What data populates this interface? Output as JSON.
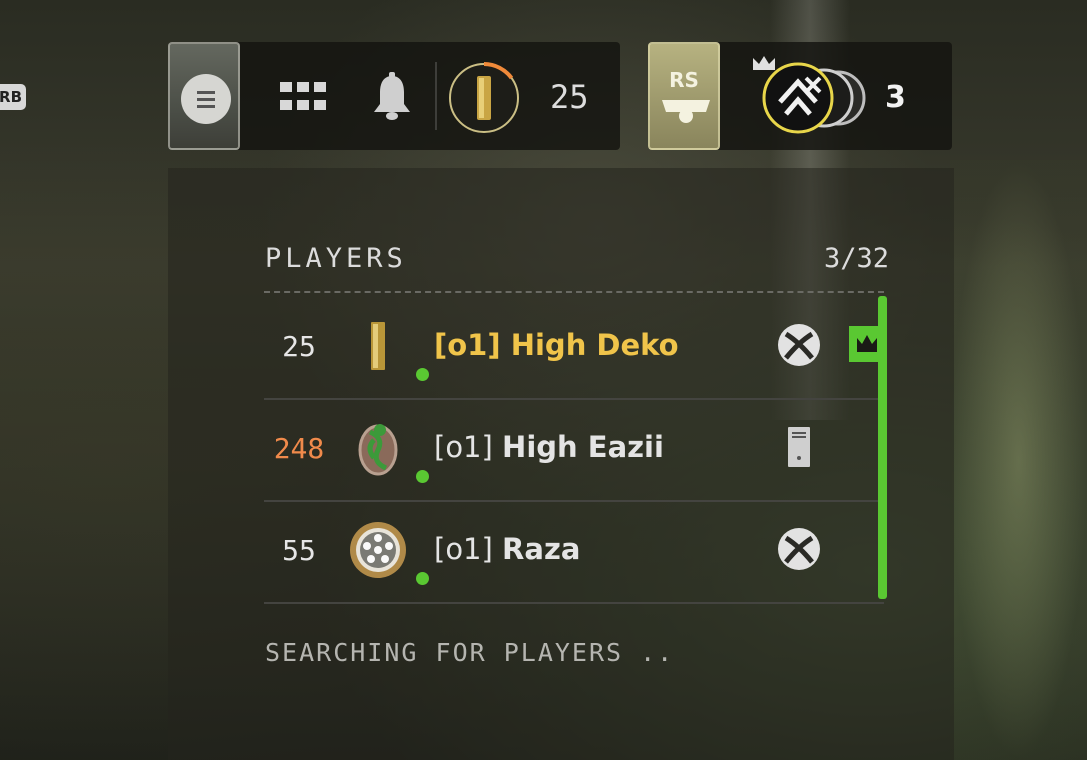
{
  "edge_hint": {
    "label": "RB"
  },
  "topbar": {
    "level": "25",
    "rs_label": "RS",
    "party_count": "3",
    "xp_progress": 0.15
  },
  "players_panel": {
    "title": "PLAYERS",
    "count": "3/32",
    "searching_text": "SEARCHING FOR PLAYERS  ..",
    "players": [
      {
        "level": "25",
        "clan": "[o1]",
        "name": "High Deko",
        "platform": "xbox-icon",
        "leader": true,
        "online": true,
        "level_color": "#e6e6e6"
      },
      {
        "level": "248",
        "clan": "[o1]",
        "name": "High Eazii",
        "platform": "pc-tower-icon",
        "leader": false,
        "online": true,
        "level_color": "#f08a4b"
      },
      {
        "level": "55",
        "clan": "[o1]",
        "name": "Raza",
        "platform": "xbox-icon",
        "leader": false,
        "online": true,
        "level_color": "#e6e6e6"
      }
    ]
  },
  "colors": {
    "online": "#5ac832",
    "leader_name": "#f0c44a",
    "prestige_level": "#f08a4b",
    "xp_ring": "#f08a3a"
  }
}
